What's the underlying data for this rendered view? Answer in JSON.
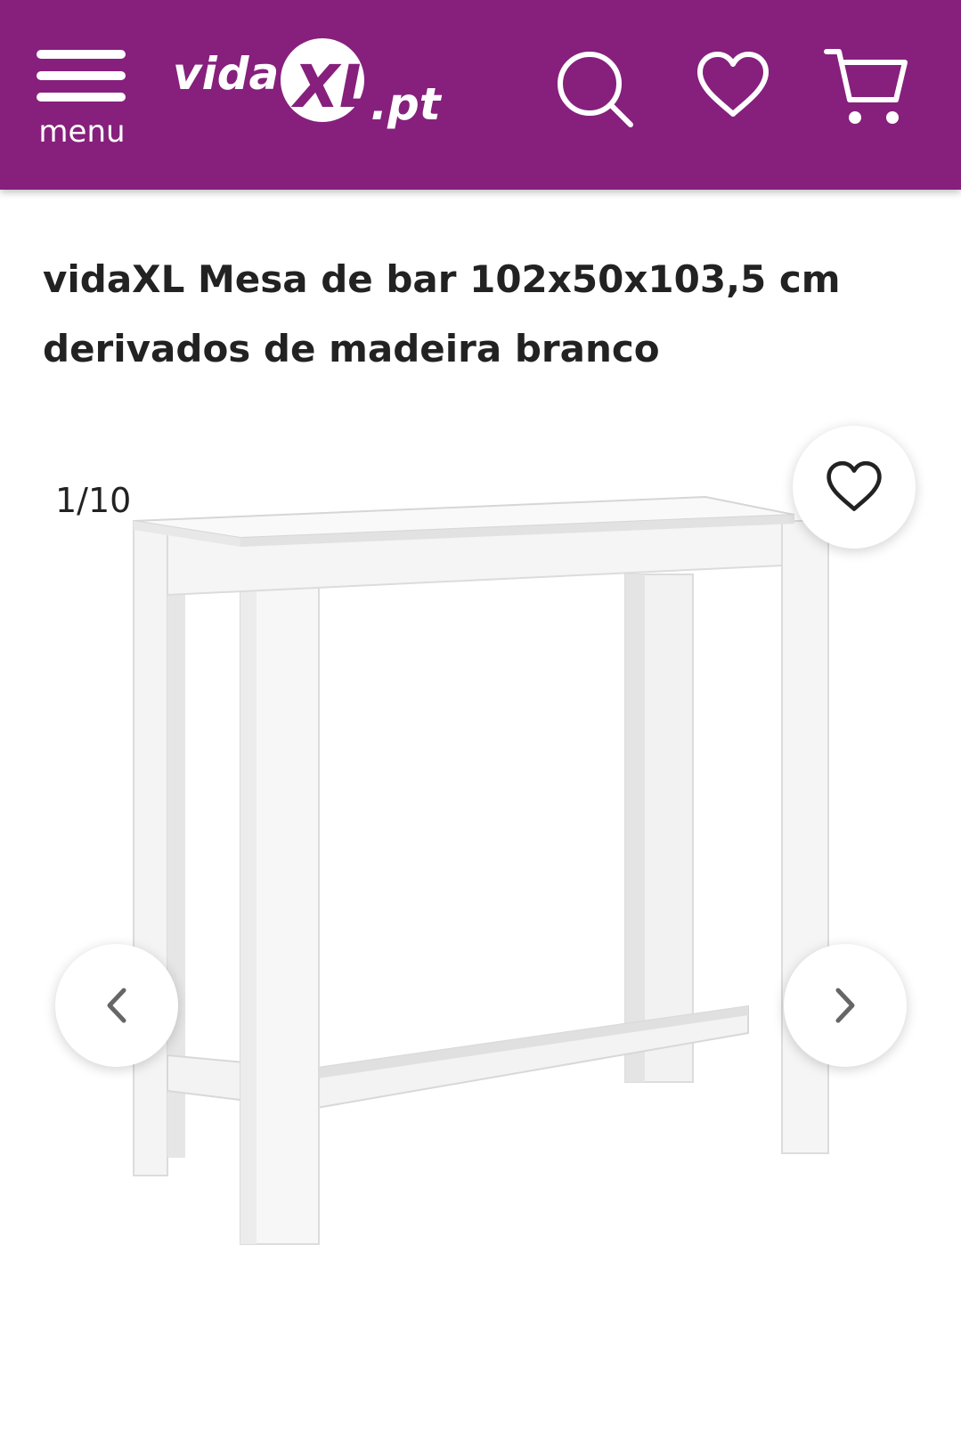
{
  "header": {
    "menu_label": "menu",
    "logo_text": "vidaXL.pt",
    "background_color": "#86207c",
    "icons": [
      "hamburger-menu-icon",
      "search-icon",
      "heart-icon",
      "cart-icon"
    ]
  },
  "product": {
    "title": "vidaXL Mesa de bar 102x50x103,5 cm derivados de madeira branco"
  },
  "gallery": {
    "counter": "1/10",
    "icons": [
      "chevron-left-icon",
      "chevron-right-icon",
      "heart-icon"
    ]
  }
}
